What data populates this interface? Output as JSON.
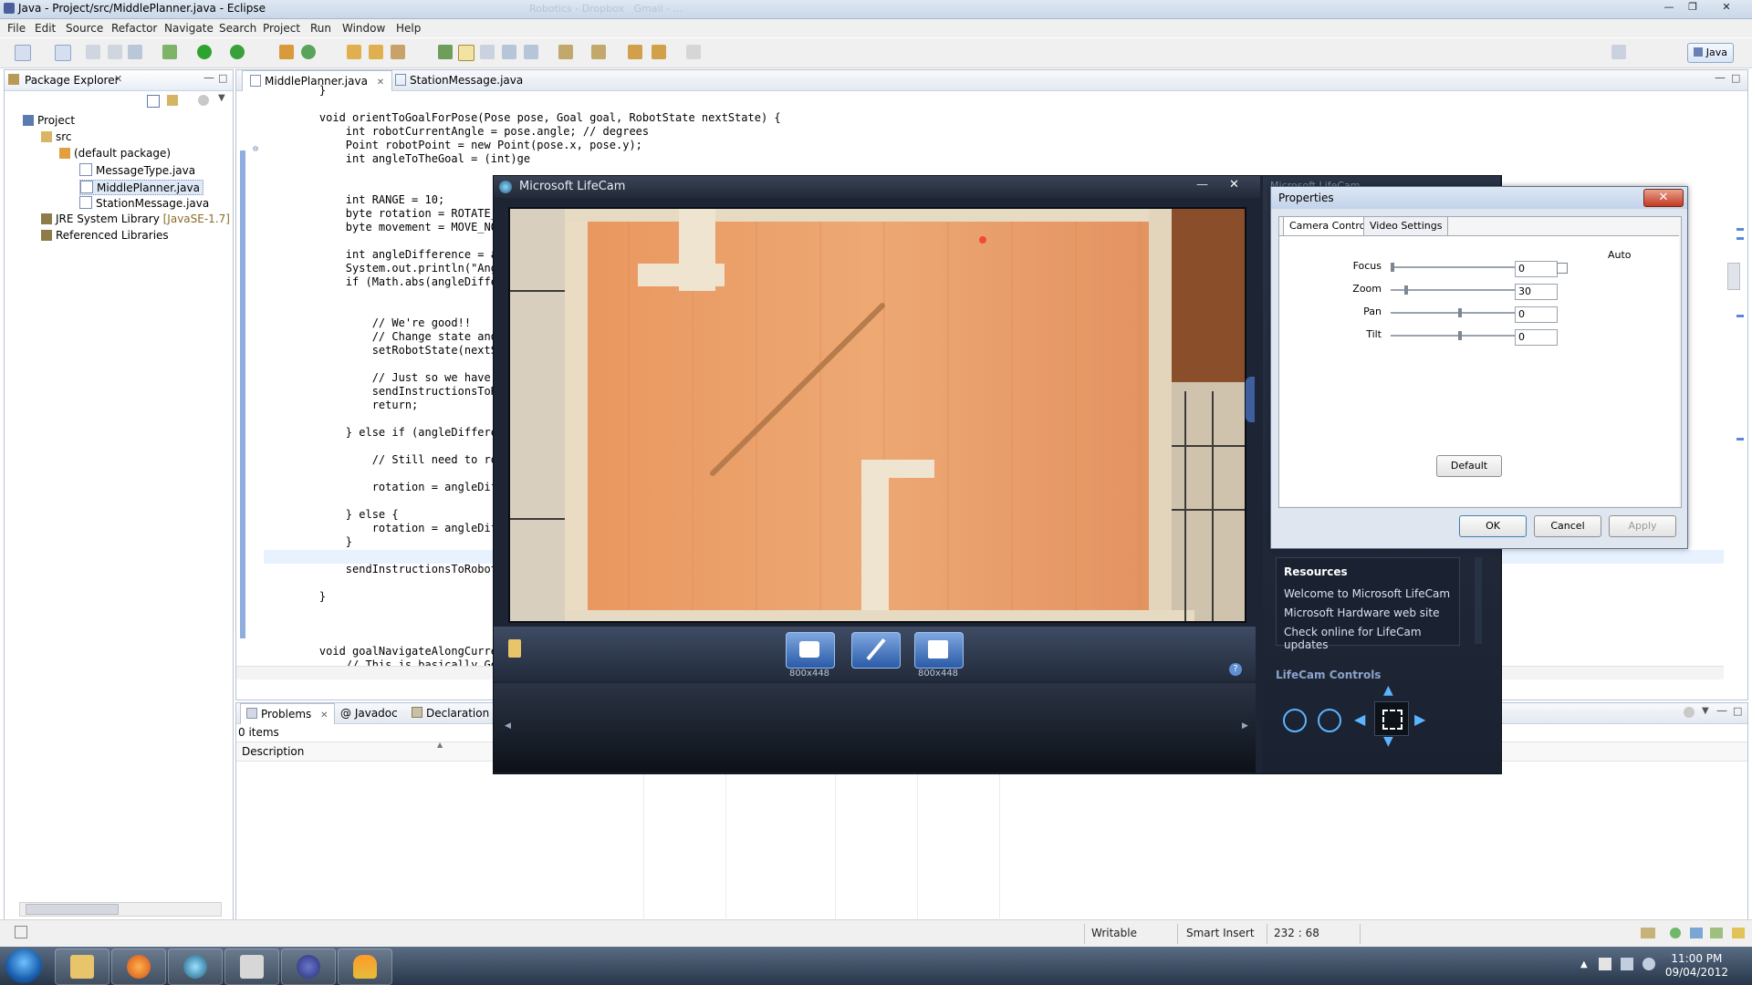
{
  "window": {
    "title": "Java - Project/src/MiddlePlanner.java - Eclipse",
    "faint_tabs": [
      "Robotics - Dropbox",
      "Gmail - ...",
      "(unreadable)"
    ]
  },
  "menubar": [
    "File",
    "Edit",
    "Source",
    "Refactor",
    "Navigate",
    "Search",
    "Project",
    "Run",
    "Window",
    "Help"
  ],
  "perspective": "Java",
  "package_explorer": {
    "title": "Package Explorer",
    "tree": [
      {
        "label": "Project",
        "indent": 0
      },
      {
        "label": "src",
        "indent": 1
      },
      {
        "label": "(default package)",
        "indent": 2
      },
      {
        "label": "MessageType.java",
        "indent": 3
      },
      {
        "label": "MiddlePlanner.java",
        "indent": 3,
        "selected": true
      },
      {
        "label": "StationMessage.java",
        "indent": 3
      },
      {
        "label": "JRE System Library",
        "suffix": "[JavaSE-1.7]",
        "indent": 1
      },
      {
        "label": "Referenced Libraries",
        "indent": 1
      }
    ]
  },
  "editor": {
    "tabs": [
      "MiddlePlanner.java",
      "StationMessage.java"
    ],
    "active_tab": 0,
    "code": [
      "    }",
      "",
      "    void orientToGoalForPose(Pose pose, Goal goal, RobotState nextState) {",
      "        int robotCurrentAngle = pose.angle; // degrees",
      "        Point robotPoint = new Point(pose.x, pose.y);",
      "        int angleToTheGoal = (int)ge",
      "",
      "",
      "        int RANGE = 10;",
      "        byte rotation = ROTATE_NONE",
      "        byte movement = MOVE_NONE;",
      "",
      "        int angleDifference = angleT",
      "        System.out.println(\"Angle di",
      "        if (Math.abs(angleDifference",
      "",
      "",
      "            // We're good!!",
      "            // Change state and rese",
      "            setRobotState(nextState)",
      "",
      "            // Just so we have some",
      "            sendInstructionsToRobot(",
      "            return;",
      "",
      "        } else if (angleDifference >",
      "",
      "            // Still need to rotate",
      "",
      "            rotation = angleDiffer",
      "",
      "        } else {",
      "            rotation = angleDiffer",
      "        }",
      "",
      "        sendInstructionsToRobot(move",
      "",
      "    }",
      "",
      "",
      "",
      "    void goalNavigateAlongCurrentPat",
      "        // This is basically Goal n"
    ]
  },
  "problems": {
    "tabs": [
      "Problems",
      "Javadoc",
      "Declaration"
    ],
    "count": "0 items",
    "column": "Description"
  },
  "statusbar": {
    "mode": "Writable",
    "insert": "Smart Insert",
    "position": "232 : 68"
  },
  "lifecam": {
    "title": "Microsoft LifeCam",
    "buttons": [
      {
        "name": "photo",
        "res": "800x448"
      },
      {
        "name": "effects",
        "res": ""
      },
      {
        "name": "video",
        "res": "800x448"
      }
    ],
    "right_title": "Microsoft LifeCam",
    "resources": {
      "title": "Resources",
      "links": [
        "Welcome to Microsoft LifeCam",
        "Microsoft Hardware web site",
        "Check online for LifeCam updates"
      ]
    },
    "controls_label": "LifeCam Controls"
  },
  "properties": {
    "title": "Properties",
    "tabs": [
      "Camera Control",
      "Video Settings"
    ],
    "auto_label": "Auto",
    "rows": [
      {
        "label": "Focus",
        "value": "0",
        "level": 0.0,
        "has_auto": true
      },
      {
        "label": "Zoom",
        "value": "30",
        "level": 0.1,
        "has_auto": false
      },
      {
        "label": "Pan",
        "value": "0",
        "level": 0.5,
        "has_auto": false
      },
      {
        "label": "Tilt",
        "value": "0",
        "level": 0.5,
        "has_auto": false
      }
    ],
    "default_label": "Default",
    "ok_label": "OK",
    "cancel_label": "Cancel",
    "apply_label": "Apply"
  },
  "taskbar": {
    "time": "11:00 PM",
    "date": "09/04/2012"
  },
  "colors": {
    "eclipse_bg": "#f0f0f0",
    "lifecam_bg": "#1d2433",
    "floor": "#e9a06a"
  }
}
